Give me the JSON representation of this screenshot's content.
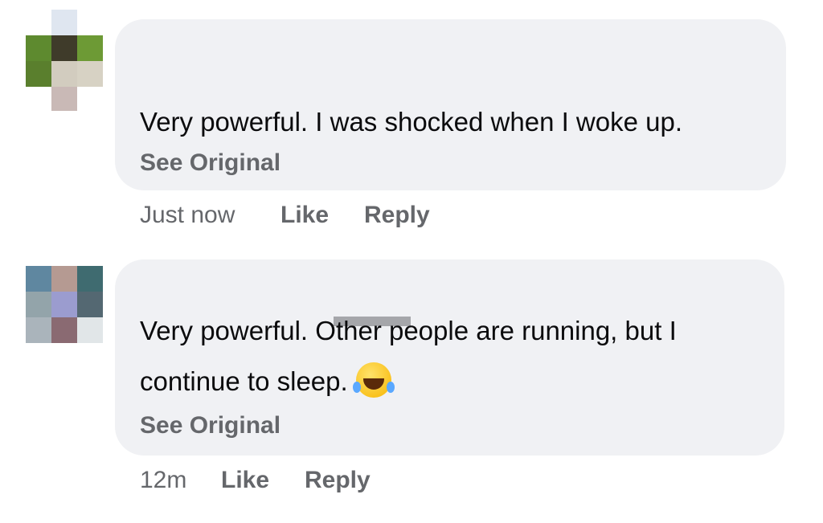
{
  "comments": [
    {
      "text_lines": [
        "Very powerful. I was shocked when I woke up."
      ],
      "see_original": "See Original",
      "time": "Just now",
      "like": "Like",
      "reply": "Reply"
    },
    {
      "text_lines": [
        "Very powerful. Other people are running, but I",
        "continue to sleep."
      ],
      "emoji": "face-with-tears-of-joy-icon",
      "see_original": "See Original",
      "time": "12m",
      "like": "Like",
      "reply": "Reply"
    }
  ],
  "colors": {
    "bubble": "#f0f1f4",
    "text": "#0b0b0d",
    "secondary": "#65676b"
  }
}
